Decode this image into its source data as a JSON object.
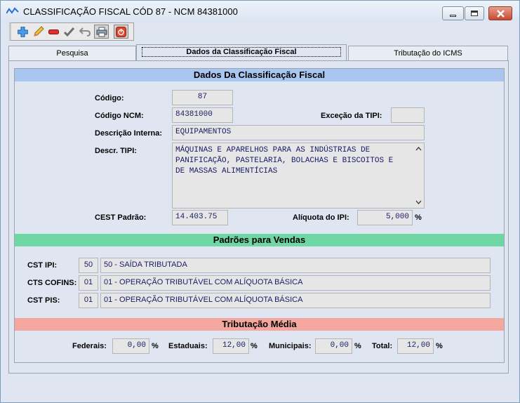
{
  "window": {
    "title": "CLASSIFICAÇÃO FISCAL CÓD 87 - NCM 84381000"
  },
  "toolbar": {
    "buttons": [
      {
        "icon": "add-icon",
        "color": "#2f7fd0"
      },
      {
        "icon": "edit-pencil-icon",
        "color": "#d8a020"
      },
      {
        "icon": "remove-icon",
        "color": "#d02020"
      },
      {
        "icon": "confirm-check-icon",
        "color": "#808080"
      },
      {
        "icon": "undo-icon",
        "color": "#808080"
      },
      {
        "icon": "print-icon",
        "color": "#6080a0"
      },
      {
        "icon": "exit-icon",
        "color": "#d04020"
      }
    ]
  },
  "tabs": [
    {
      "label": "Pesquisa"
    },
    {
      "label": "Dados da Classificação Fiscal"
    },
    {
      "label": "Tributação do ICMS"
    }
  ],
  "dados": {
    "header": "Dados Da Classificação Fiscal",
    "header_color": "#a9c6f0",
    "codigo_label": "Código:",
    "codigo_value": "87",
    "ncm_label": "Código NCM:",
    "ncm_value": "84381000",
    "excecao_label": "Exceção da TIPI:",
    "excecao_value": "",
    "descr_interna_label": "Descrição Interna:",
    "descr_interna_value": "EQUIPAMENTOS",
    "descr_tipi_label": "Descr. TIPI:",
    "descr_tipi_lines": [
      "MÁQUINAS E APARELHOS PARA AS INDÚSTRIAS DE",
      "PANIFICAÇÃO, PASTELARIA, BOLACHAS E BISCOITOS E",
      "DE MASSAS ALIMENTÍCIAS"
    ],
    "cest_label": "CEST Padrão:",
    "cest_value": "14.403.75",
    "aliquota_label": "Alíquota do IPI:",
    "aliquota_value": "5,000",
    "aliquota_unit": "%"
  },
  "vendas": {
    "header": "Padrões para Vendas",
    "header_color": "#6fd7a3",
    "rows": [
      {
        "label": "CST IPI:",
        "code": "50",
        "desc": "50 - SAÍDA TRIBUTADA"
      },
      {
        "label": "CTS COFINS:",
        "code": "01",
        "desc": "01 - OPERAÇÃO TRIBUTÁVEL COM ALÍQUOTA BÁSICA"
      },
      {
        "label": "CST PIS:",
        "code": "01",
        "desc": "01 - OPERAÇÃO TRIBUTÁVEL COM ALÍQUOTA BÁSICA"
      }
    ]
  },
  "tributacao": {
    "header": "Tributação Média",
    "header_color": "#f4a79e",
    "federais_label": "Federais:",
    "federais_value": "0,00",
    "estaduais_label": "Estaduais:",
    "estaduais_value": "12,00",
    "municipais_label": "Municipais:",
    "municipais_value": "0,00",
    "total_label": "Total:",
    "total_value": "12,00",
    "unit": "%"
  }
}
